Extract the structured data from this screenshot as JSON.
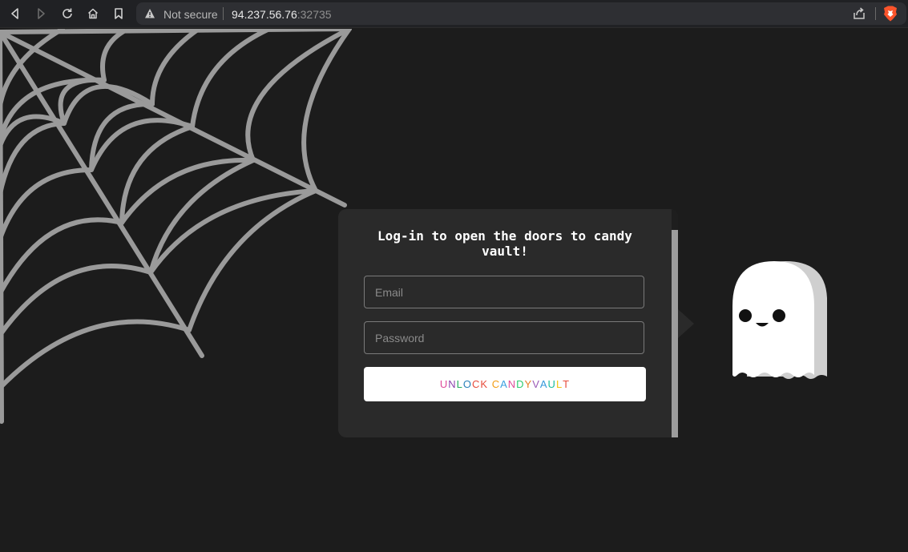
{
  "browser": {
    "security_label": "Not secure",
    "url_host": "94.237.56.76",
    "url_port": ":32735",
    "icons": [
      "back-icon",
      "forward-icon",
      "reload-icon",
      "home-icon",
      "bookmark-icon",
      "warning-icon",
      "share-icon",
      "brave-lion-icon"
    ]
  },
  "login": {
    "title": "Log-in to open the doors to candy vault!",
    "email_placeholder": "Email",
    "password_placeholder": "Password",
    "button_label": "UNLOCK CANDYVAULT",
    "button_letter_colors": [
      "#e04b9a",
      "#8e44ad",
      "#27ae60",
      "#2980b9",
      "#e74c3c",
      "#e74c3c",
      "#ffffff",
      "#f39c12",
      "#3aa0e0",
      "#e04b9a",
      "#2ecc71",
      "#e67e22",
      "#9b59b6",
      "#3498db",
      "#1abc9c",
      "#f1c40f",
      "#e74c3c"
    ]
  },
  "colors": {
    "page_bg": "#1c1c1c",
    "card_bg": "#2a2a2a",
    "web": "#9a9a9a",
    "ghost": "#ffffff"
  }
}
